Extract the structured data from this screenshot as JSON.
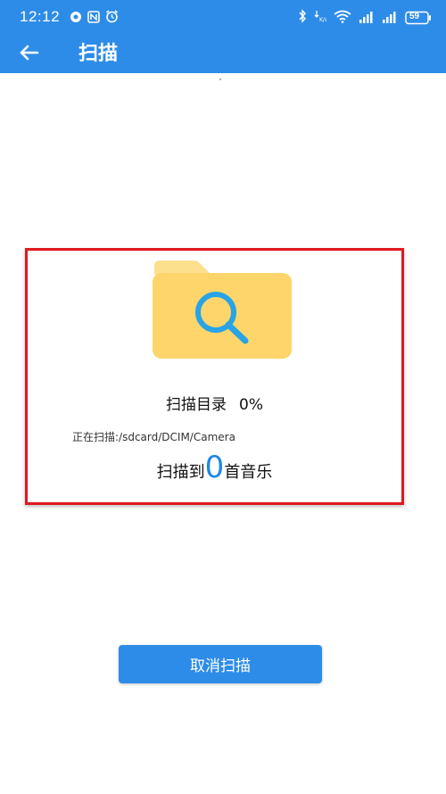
{
  "status_bar": {
    "time": "12:12",
    "battery": "59"
  },
  "app_bar": {
    "title": "扫描"
  },
  "scan": {
    "progress_label": "扫描目录",
    "progress_percent": "0%",
    "current_path": "正在扫描:/sdcard/DCIM/Camera",
    "result_prefix": "扫描到",
    "result_count": "0",
    "result_suffix": "首音乐"
  },
  "actions": {
    "cancel_label": "取消扫描"
  },
  "colors": {
    "primary": "#2d8ce8",
    "highlight_border": "#e0191f",
    "count_blue": "#1e88e5",
    "folder_yellow": "#fdd56a",
    "folder_tab": "#fde08e",
    "magnifier_blue": "#29a3e6"
  }
}
